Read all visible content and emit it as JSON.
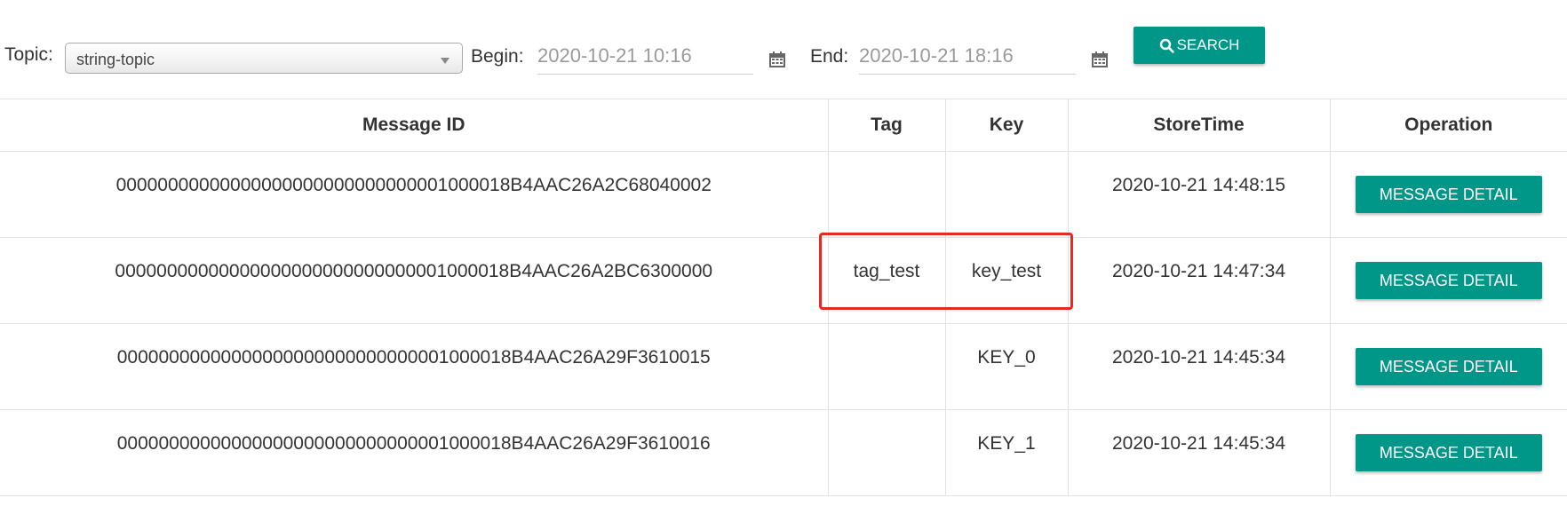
{
  "filters": {
    "topic_label": "Topic:",
    "topic_value": "string-topic",
    "begin_label": "Begin:",
    "begin_value": "2020-10-21 10:16",
    "end_label": "End:",
    "end_value": "2020-10-21 18:16",
    "search_label": "SEARCH"
  },
  "table": {
    "headers": {
      "message_id": "Message ID",
      "tag": "Tag",
      "key": "Key",
      "store_time": "StoreTime",
      "operation": "Operation"
    },
    "rows": [
      {
        "message_id": "00000000000000000000000000000001000018B4AAC26A2C68040002",
        "tag": "",
        "key": "",
        "store_time": "2020-10-21 14:48:15",
        "action": "MESSAGE DETAIL"
      },
      {
        "message_id": "00000000000000000000000000000001000018B4AAC26A2BC6300000",
        "tag": "tag_test",
        "key": "key_test",
        "store_time": "2020-10-21 14:47:34",
        "action": "MESSAGE DETAIL"
      },
      {
        "message_id": "00000000000000000000000000000001000018B4AAC26A29F3610015",
        "tag": "",
        "key": "KEY_0",
        "store_time": "2020-10-21 14:45:34",
        "action": "MESSAGE DETAIL"
      },
      {
        "message_id": "00000000000000000000000000000001000018B4AAC26A29F3610016",
        "tag": "",
        "key": "KEY_1",
        "store_time": "2020-10-21 14:45:34",
        "action": "MESSAGE DETAIL"
      }
    ]
  },
  "icons": {
    "search": "search-icon",
    "calendar": "calendar-icon",
    "dropdown": "chevron-down-icon"
  },
  "colors": {
    "accent": "#009688",
    "highlight": "#e8291f"
  }
}
